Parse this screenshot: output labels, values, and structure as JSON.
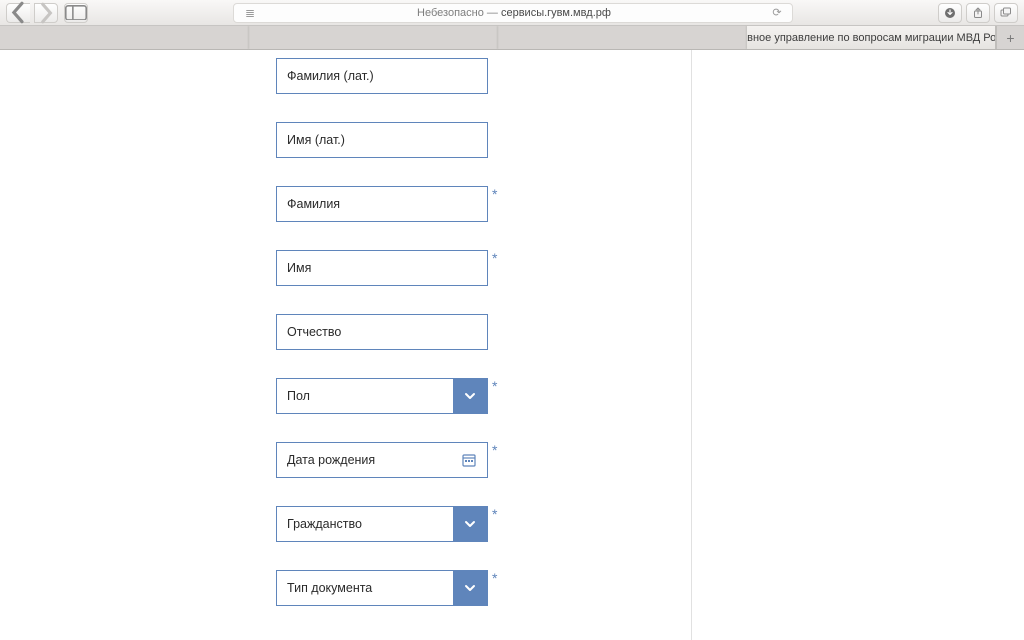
{
  "browser": {
    "insecure_prefix": "Небезопасно — ",
    "url_host": "сервисы.гувм.мвд.рф"
  },
  "tabs": {
    "t1": "",
    "t2": "",
    "t3": "",
    "t4": "Главное управление по вопросам миграции МВД Рос…"
  },
  "form": {
    "surname_lat": {
      "label": "Фамилия (лат.)",
      "required": false,
      "type": "text"
    },
    "name_lat": {
      "label": "Имя (лат.)",
      "required": false,
      "type": "text"
    },
    "surname": {
      "label": "Фамилия",
      "required": true,
      "type": "text"
    },
    "name": {
      "label": "Имя",
      "required": true,
      "type": "text"
    },
    "patronymic": {
      "label": "Отчество",
      "required": false,
      "type": "text"
    },
    "gender": {
      "label": "Пол",
      "required": true,
      "type": "select"
    },
    "birthdate": {
      "label": "Дата рождения",
      "required": true,
      "type": "date"
    },
    "citizenship": {
      "label": "Гражданство",
      "required": true,
      "type": "select"
    },
    "doc_type": {
      "label": "Тип документа",
      "required": true,
      "type": "select"
    }
  }
}
